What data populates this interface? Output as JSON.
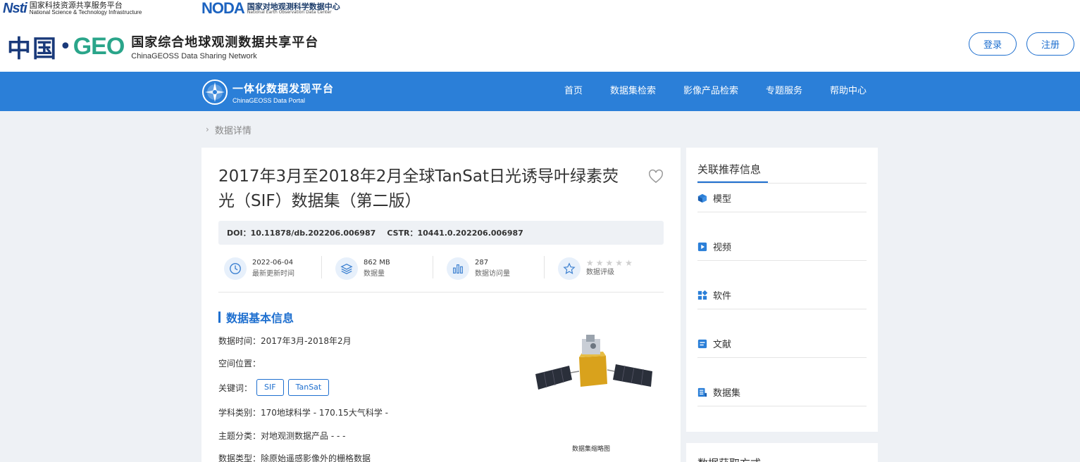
{
  "partners": {
    "nstl": {
      "mark": "Nsti",
      "cn": "国家科技资源共享服务平台",
      "en": "National Science & Technology Infrastructure"
    },
    "noda": {
      "mark": "NODA",
      "cn": "国家对地观测科学数据中心",
      "en": "National Earth Observation Data Center"
    }
  },
  "site": {
    "cn_mark": "中国",
    "geo_mark": "GEO",
    "title": "国家综合地球观测数据共享平台",
    "subtitle": "ChinaGEOSS Data Sharing Network"
  },
  "auth": {
    "login": "登录",
    "register": "注册"
  },
  "portal": {
    "title": "一体化数据发现平台",
    "subtitle": "ChinaGEOSS Data Portal"
  },
  "nav": [
    "首页",
    "数据集检索",
    "影像产品检索",
    "专题服务",
    "帮助中心"
  ],
  "breadcrumb": "数据详情",
  "dataset": {
    "title": "2017年3月至2018年2月全球TanSat日光诱导叶绿素荧光（SIF）数据集（第二版）",
    "doi": "DOI：10.11878/db.202206.006987",
    "cstr": "CSTR：10441.0.202206.006987",
    "stats": {
      "updated": {
        "value": "2022-06-04",
        "label": "最新更新时间"
      },
      "size": {
        "value": "862 MB",
        "label": "数据量"
      },
      "visits": {
        "value": "287",
        "label": "数据访问量"
      },
      "rating": {
        "label": "数据评级",
        "score": 0,
        "max": 5
      }
    },
    "section_title": "数据基本信息",
    "time": "数据时间：2017年3月-2018年2月",
    "location": "空间位置：",
    "keywords_label": "关键词：",
    "keywords": [
      "SIF",
      "TanSat"
    ],
    "discipline": "学科类别：170地球科学 - 170.15大气科学 -",
    "theme": "主题分类：对地观测数据产品 - - -",
    "data_type": "数据类型：除原始遥感影像外的栅格数据",
    "thumbnail_caption": "数据集缩略图"
  },
  "sidebar": {
    "title": "关联推荐信息",
    "items": [
      {
        "label": "模型",
        "icon": "cube-icon"
      },
      {
        "label": "视频",
        "icon": "play-icon"
      },
      {
        "label": "软件",
        "icon": "apps-icon"
      },
      {
        "label": "文献",
        "icon": "document-icon"
      },
      {
        "label": "数据集",
        "icon": "dataset-icon"
      }
    ],
    "access_title": "数据获取方式"
  },
  "colors": {
    "primary": "#2b7fd8",
    "accent": "#1e6fcf",
    "background": "#eef1f5"
  }
}
